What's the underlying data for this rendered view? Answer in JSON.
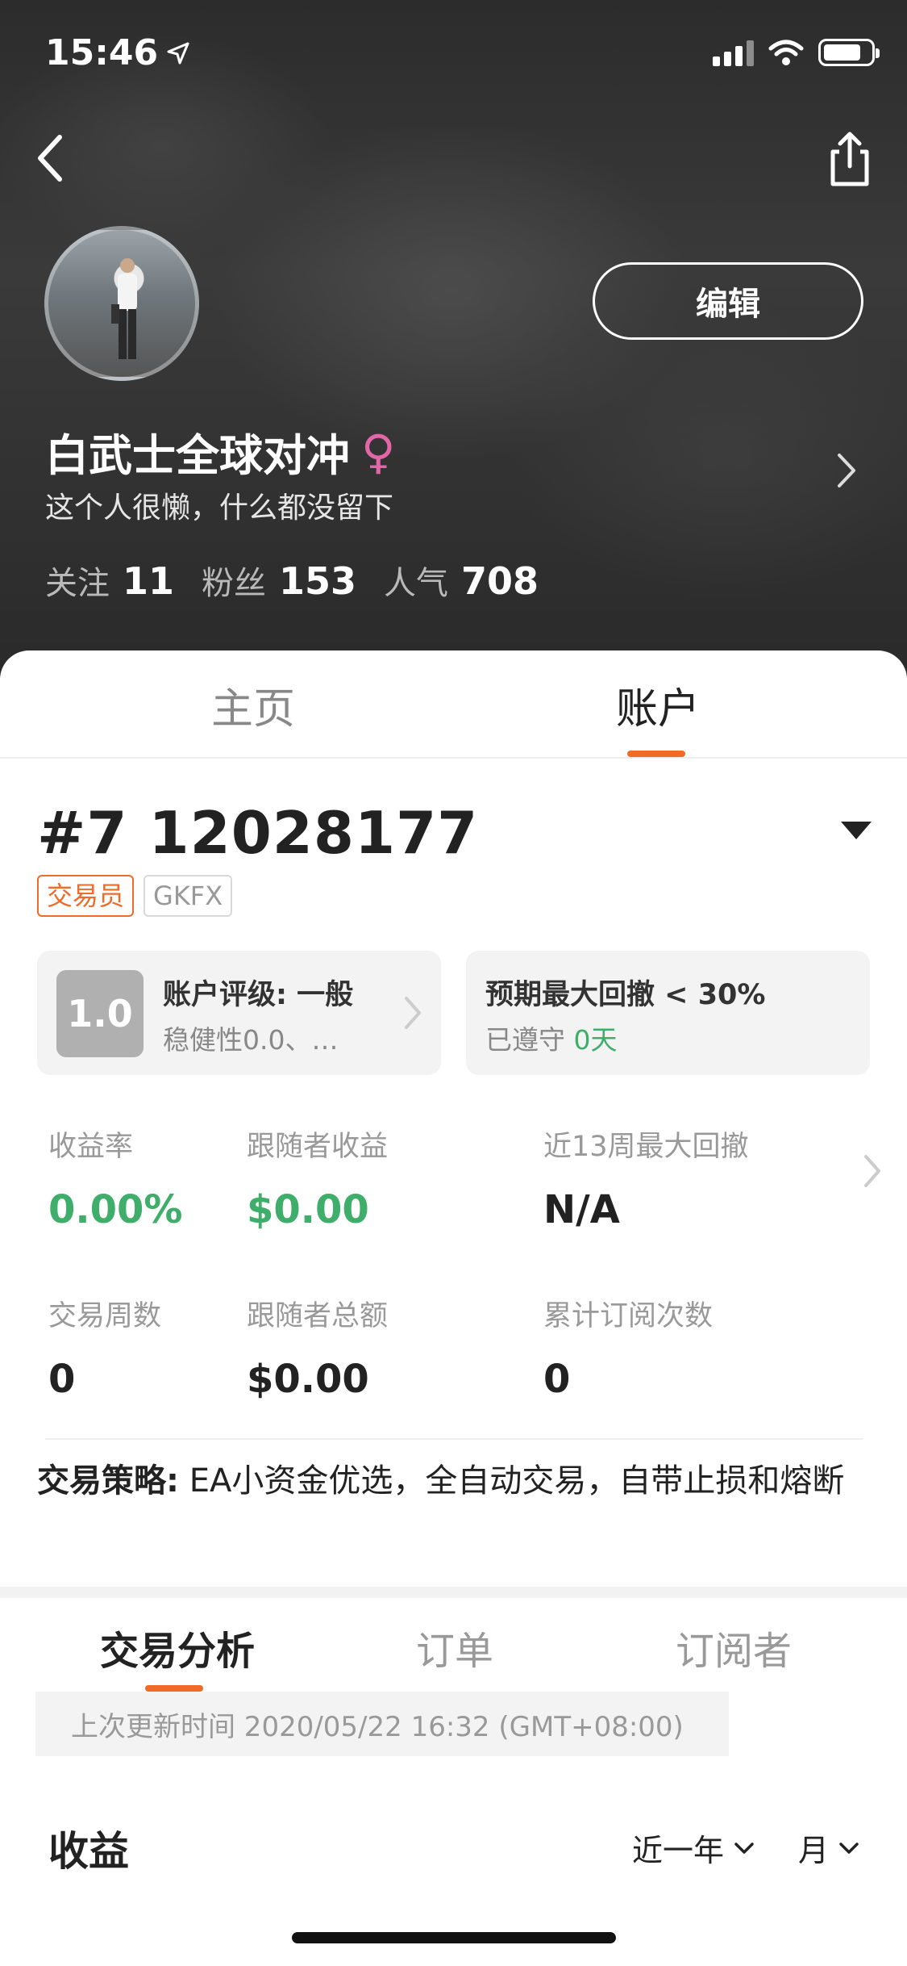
{
  "status_bar": {
    "time": "15:46"
  },
  "profile": {
    "edit_label": "编辑",
    "name": "白武士全球对冲",
    "gender_symbol": "♀",
    "bio": "这个人很懒，什么都没留下",
    "stats": [
      {
        "label": "关注",
        "value": "11"
      },
      {
        "label": "粉丝",
        "value": "153"
      },
      {
        "label": "人气",
        "value": "708"
      }
    ]
  },
  "tabs": {
    "home": "主页",
    "account": "账户"
  },
  "account": {
    "number": "#7 12028177",
    "tags": {
      "role": "交易员",
      "broker": "GKFX"
    },
    "rating": {
      "score": "1.0",
      "title": "账户评级: 一般",
      "subtitle": "稳健性0.0、…"
    },
    "drawdown": {
      "title": "预期最大回撤 < 30%",
      "status_prefix": "已遵守",
      "days": "0天"
    },
    "metrics": [
      {
        "label": "收益率",
        "value": "0.00%"
      },
      {
        "label": "跟随者收益",
        "value": "$0.00"
      },
      {
        "label": "近13周最大回撤",
        "value": "N/A"
      },
      {
        "label": "交易周数",
        "value": "0"
      },
      {
        "label": "跟随者总额",
        "value": "$0.00"
      },
      {
        "label": "累计订阅次数",
        "value": "0"
      }
    ],
    "strategy_label": "交易策略:",
    "strategy_text": " EA小资金优选，全自动交易，自带止损和熔断"
  },
  "analysis_tabs": [
    "交易分析",
    "订单",
    "订阅者"
  ],
  "last_update": "上次更新时间 2020/05/22 16:32 (GMT+08:00)",
  "earnings": {
    "title": "收益",
    "range": "近一年",
    "granularity": "月"
  },
  "colors": {
    "accent": "#f06a28",
    "positive": "#3fae6a",
    "female": "#e266a8"
  }
}
